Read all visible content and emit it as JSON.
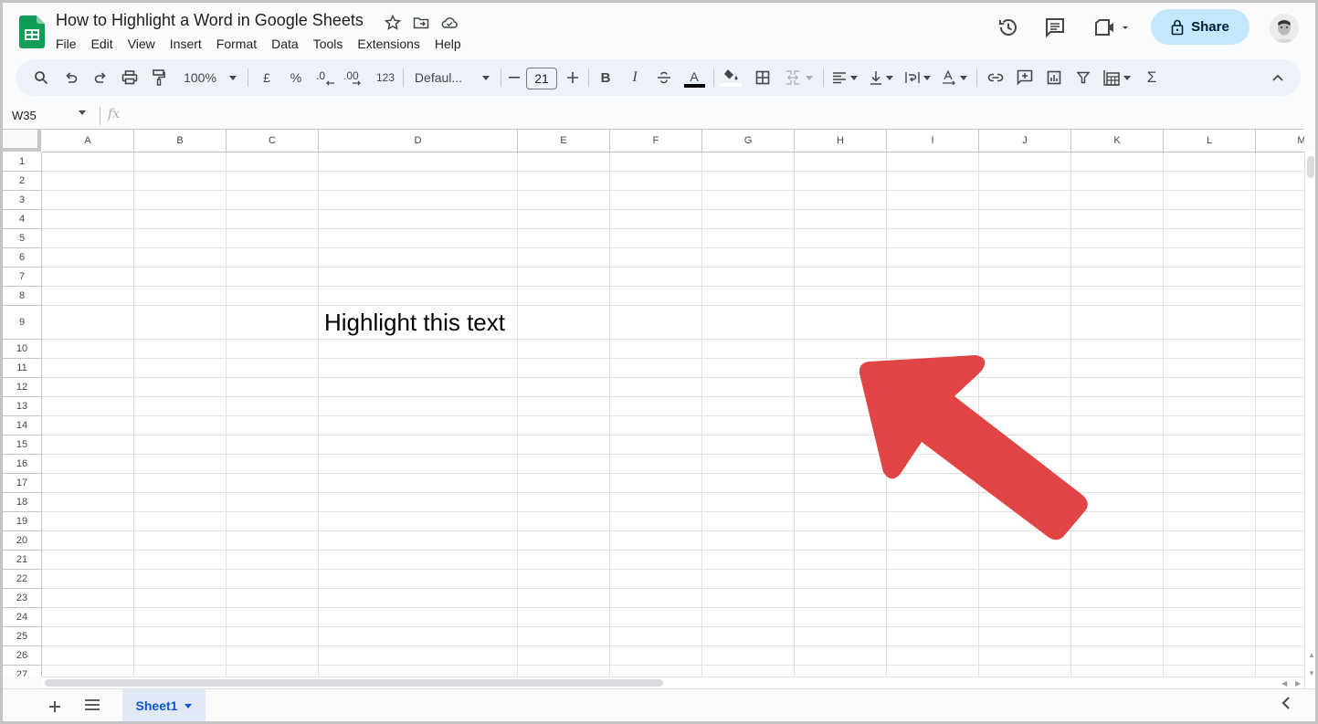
{
  "header": {
    "title": "How to Highlight a Word in Google Sheets",
    "menu": [
      "File",
      "Edit",
      "View",
      "Insert",
      "Format",
      "Data",
      "Tools",
      "Extensions",
      "Help"
    ],
    "share_label": "Share"
  },
  "toolbar": {
    "zoom": "100%",
    "currency": "£",
    "percent": "%",
    "decrease_decimal": ".0",
    "increase_decimal": ".00",
    "number_format": "123",
    "font": "Defaul...",
    "font_size": "21",
    "bold": "B",
    "italic": "I",
    "text_color": "A",
    "sum": "Σ"
  },
  "formula_bar": {
    "name_box": "W35",
    "fx": "fx",
    "formula": ""
  },
  "grid": {
    "columns": [
      "A",
      "B",
      "C",
      "D",
      "E",
      "F",
      "G",
      "H",
      "I",
      "J",
      "K",
      "L",
      "M"
    ],
    "rows": [
      "1",
      "2",
      "3",
      "4",
      "5",
      "6",
      "7",
      "8",
      "9",
      "10",
      "11",
      "12",
      "13",
      "14",
      "15",
      "16",
      "17",
      "18",
      "19",
      "20",
      "21",
      "22",
      "23",
      "24",
      "25",
      "26",
      "27"
    ],
    "cells": {
      "D9": "Highlight this text"
    }
  },
  "sheets": {
    "tabs": [
      "Sheet1"
    ],
    "active": "Sheet1"
  },
  "annotation": {
    "arrow_color": "#e04444",
    "direction": "up-left"
  },
  "colors": {
    "share_bg": "#c2e7ff",
    "sheet_tab_active": "#0b57d0",
    "toolbar_bg": "#edf2fa",
    "sheets_logo": "#0f9d58"
  }
}
